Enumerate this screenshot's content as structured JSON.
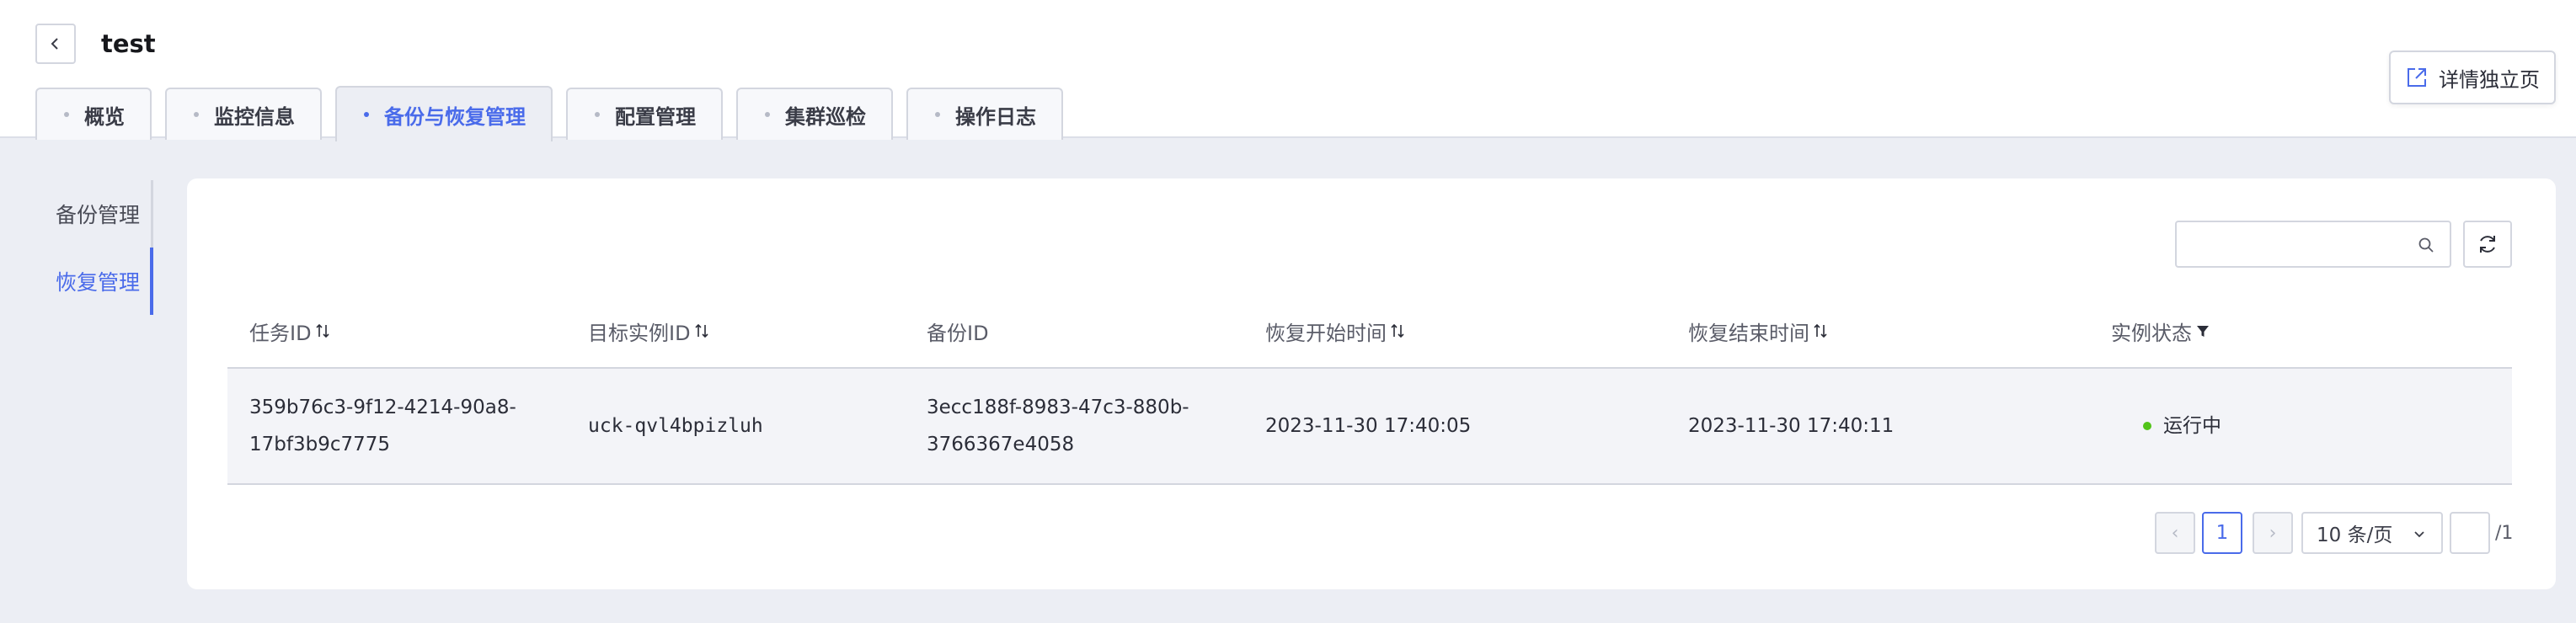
{
  "header": {
    "title": "test",
    "detail_button_label": "详情独立页"
  },
  "tabs": [
    {
      "label": "概览"
    },
    {
      "label": "监控信息"
    },
    {
      "label": "备份与恢复管理",
      "active": true
    },
    {
      "label": "配置管理"
    },
    {
      "label": "集群巡检"
    },
    {
      "label": "操作日志"
    }
  ],
  "side_nav": [
    {
      "label": "备份管理"
    },
    {
      "label": "恢复管理",
      "active": true
    }
  ],
  "toolbar": {
    "search_value": "",
    "search_placeholder": ""
  },
  "table": {
    "columns": [
      {
        "label": "任务ID",
        "sortable": true
      },
      {
        "label": "目标实例ID",
        "sortable": true
      },
      {
        "label": "备份ID",
        "sortable": false
      },
      {
        "label": "恢复开始时间",
        "sortable": true
      },
      {
        "label": "恢复结束时间",
        "sortable": true
      },
      {
        "label": "实例状态",
        "filterable": true
      }
    ],
    "rows": [
      {
        "task_id_line1": "359b76c3-9f12-4214-90a8-",
        "task_id_line2": "17bf3b9c7775",
        "target_instance_id": "uck-qvl4bpizluh",
        "backup_id_line1": "3ecc188f-8983-47c3-880b-",
        "backup_id_line2": "3766367e4058",
        "restore_start": "2023-11-30 17:40:05",
        "restore_end": "2023-11-30 17:40:11",
        "status": "运行中",
        "status_color": "#52c41a"
      }
    ]
  },
  "pagination": {
    "prev": "‹",
    "current_page": "1",
    "next": "›",
    "page_size": "10 条/页",
    "jump_value": "",
    "total_pages": "/1"
  },
  "colors": {
    "accent": "#4a6bea",
    "background": "#eceef4",
    "status_running": "#52c41a"
  }
}
